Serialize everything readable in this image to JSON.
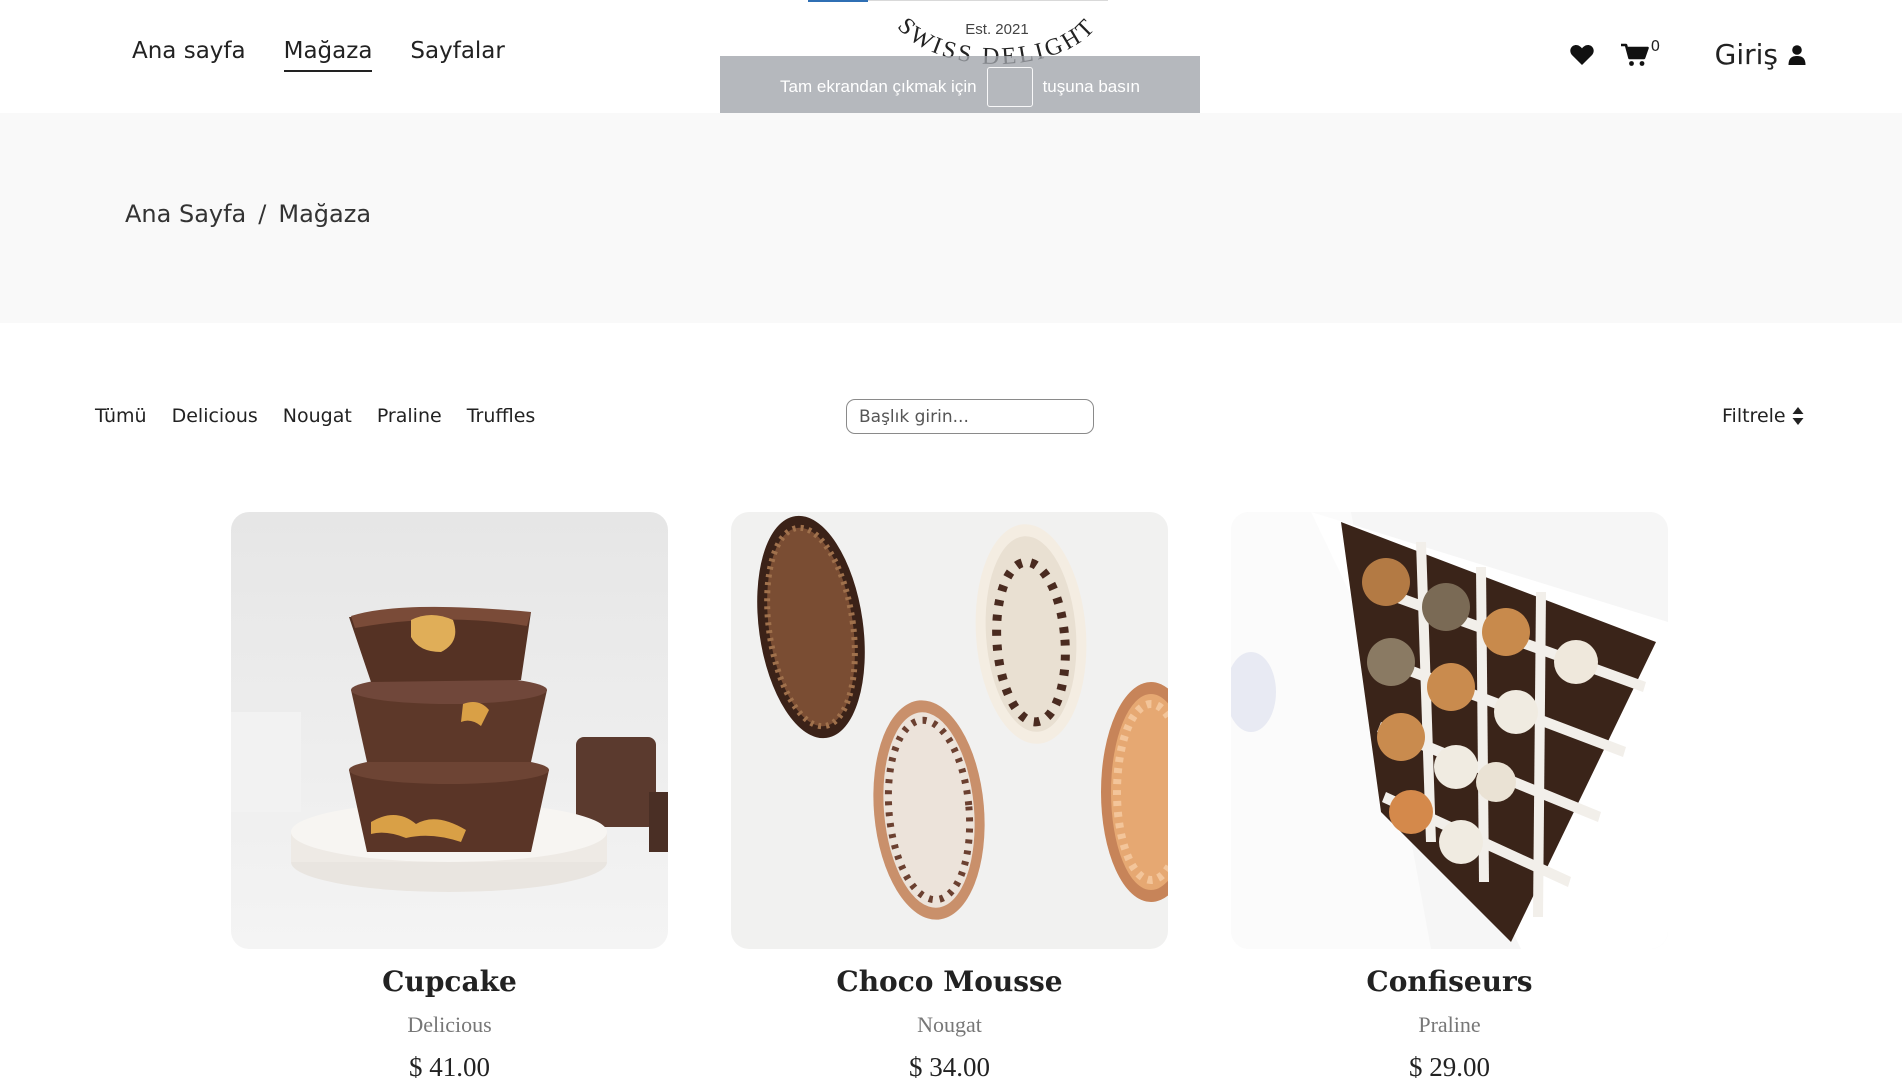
{
  "nav": {
    "items": [
      {
        "label": "Ana sayfa",
        "active": false
      },
      {
        "label": "Mağaza",
        "active": true
      },
      {
        "label": "Sayfalar",
        "active": false
      }
    ]
  },
  "logo": {
    "text": "SWISS DELIGHT",
    "est": "Est. 2021"
  },
  "fullscreen_toast": {
    "before": "Tam ekrandan çıkmak için",
    "after": "tuşuna basın"
  },
  "header_icons": {
    "wishlist": "heart-icon",
    "cart": "cart-icon",
    "cart_count": "0",
    "login_label": "Giriş",
    "user": "user-icon"
  },
  "breadcrumb": {
    "home": "Ana Sayfa",
    "separator": "/",
    "current": "Mağaza"
  },
  "filters": {
    "categories": [
      "Tümü",
      "Delicious",
      "Nougat",
      "Praline",
      "Truffles"
    ],
    "search_placeholder": "Başlık girin...",
    "filter_label": "Filtrele"
  },
  "products": [
    {
      "name": "Cupcake",
      "category": "Delicious",
      "price": "$ 41.00"
    },
    {
      "name": "Choco Mousse",
      "category": "Nougat",
      "price": "$ 34.00"
    },
    {
      "name": "Confiseurs",
      "category": "Praline",
      "price": "$ 29.00"
    }
  ],
  "colors": {
    "band": "#f9f9f9",
    "accent": "#2f6fb4",
    "text": "#222222"
  }
}
